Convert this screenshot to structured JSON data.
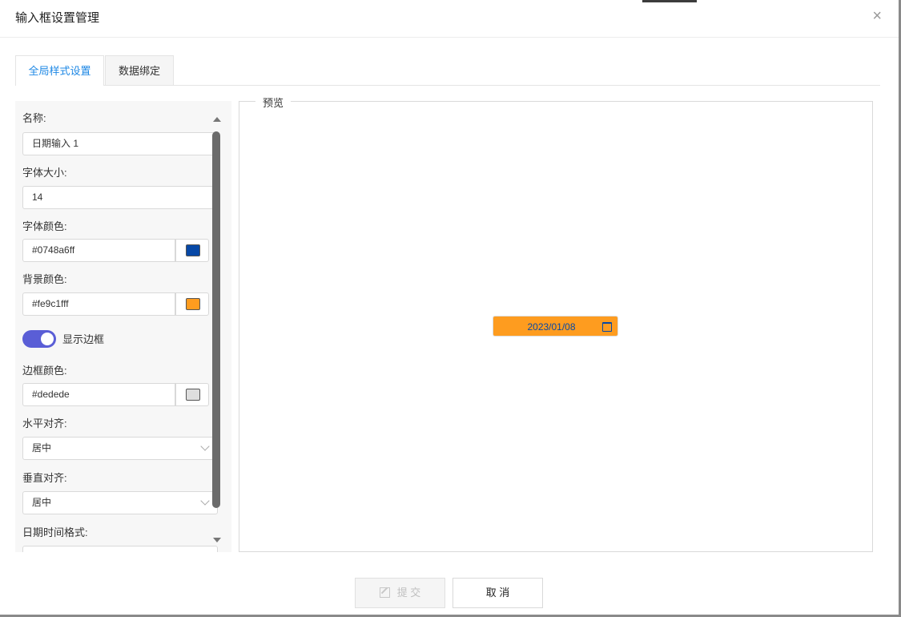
{
  "dialog": {
    "title": "输入框设置管理",
    "close_glyph": "×"
  },
  "tabs": [
    {
      "label": "全局样式设置",
      "active": true
    },
    {
      "label": "数据绑定",
      "active": false
    }
  ],
  "form": {
    "name_label": "名称:",
    "name_value": "日期输入 1",
    "font_size_label": "字体大小:",
    "font_size_value": "14",
    "font_color_label": "字体颜色:",
    "font_color_value": "#0748a6ff",
    "font_color_swatch": "#0748a6",
    "bg_color_label": "背景颜色:",
    "bg_color_value": "#fe9c1fff",
    "bg_color_swatch": "#fe9c1f",
    "show_border_label": "显示边框",
    "show_border_on": true,
    "border_color_label": "边框颜色:",
    "border_color_value": "#dedede",
    "border_color_swatch": "#dedede",
    "h_align_label": "水平对齐:",
    "h_align_value": "居中",
    "v_align_label": "垂直对齐:",
    "v_align_value": "居中",
    "datetime_format_label": "日期时间格式:"
  },
  "preview": {
    "legend": "预览",
    "date_value": "2023/01/08"
  },
  "footer": {
    "submit_label": "提 交",
    "submit_disabled": true,
    "cancel_label": "取 消"
  },
  "colors": {
    "accent": "#1e88e5",
    "toggle": "#5a5ed6"
  },
  "icons": {
    "close": "close-icon",
    "calendar": "calendar-icon",
    "chevron": "chevron-down-icon",
    "edit": "edit-icon"
  }
}
